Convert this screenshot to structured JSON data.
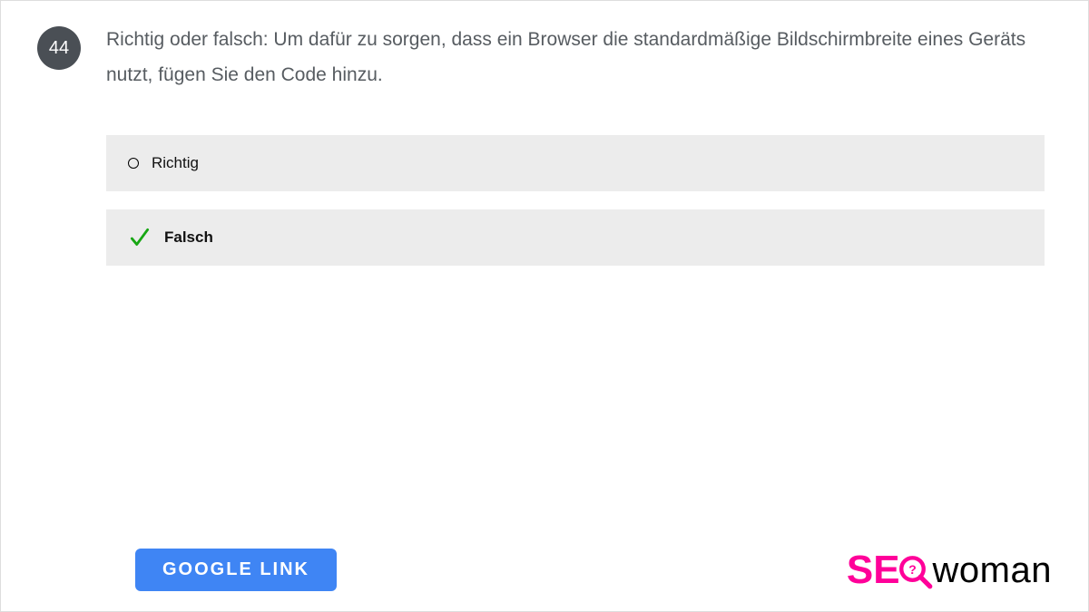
{
  "question": {
    "number": "44",
    "text": "Richtig oder falsch: Um dafür zu sorgen, dass ein Browser die standardmäßige Bildschirmbreite eines Geräts nutzt, fügen Sie den Code hinzu."
  },
  "options": [
    {
      "label": "Richtig",
      "correct": false
    },
    {
      "label": "Falsch",
      "correct": true
    }
  ],
  "button": {
    "label": "GOOGLE   LINK"
  },
  "logo": {
    "part1": "SE",
    "part2": "woman"
  },
  "colors": {
    "accent_blue": "#3f85f4",
    "accent_pink": "#ff0099",
    "check_green": "#18a714"
  }
}
